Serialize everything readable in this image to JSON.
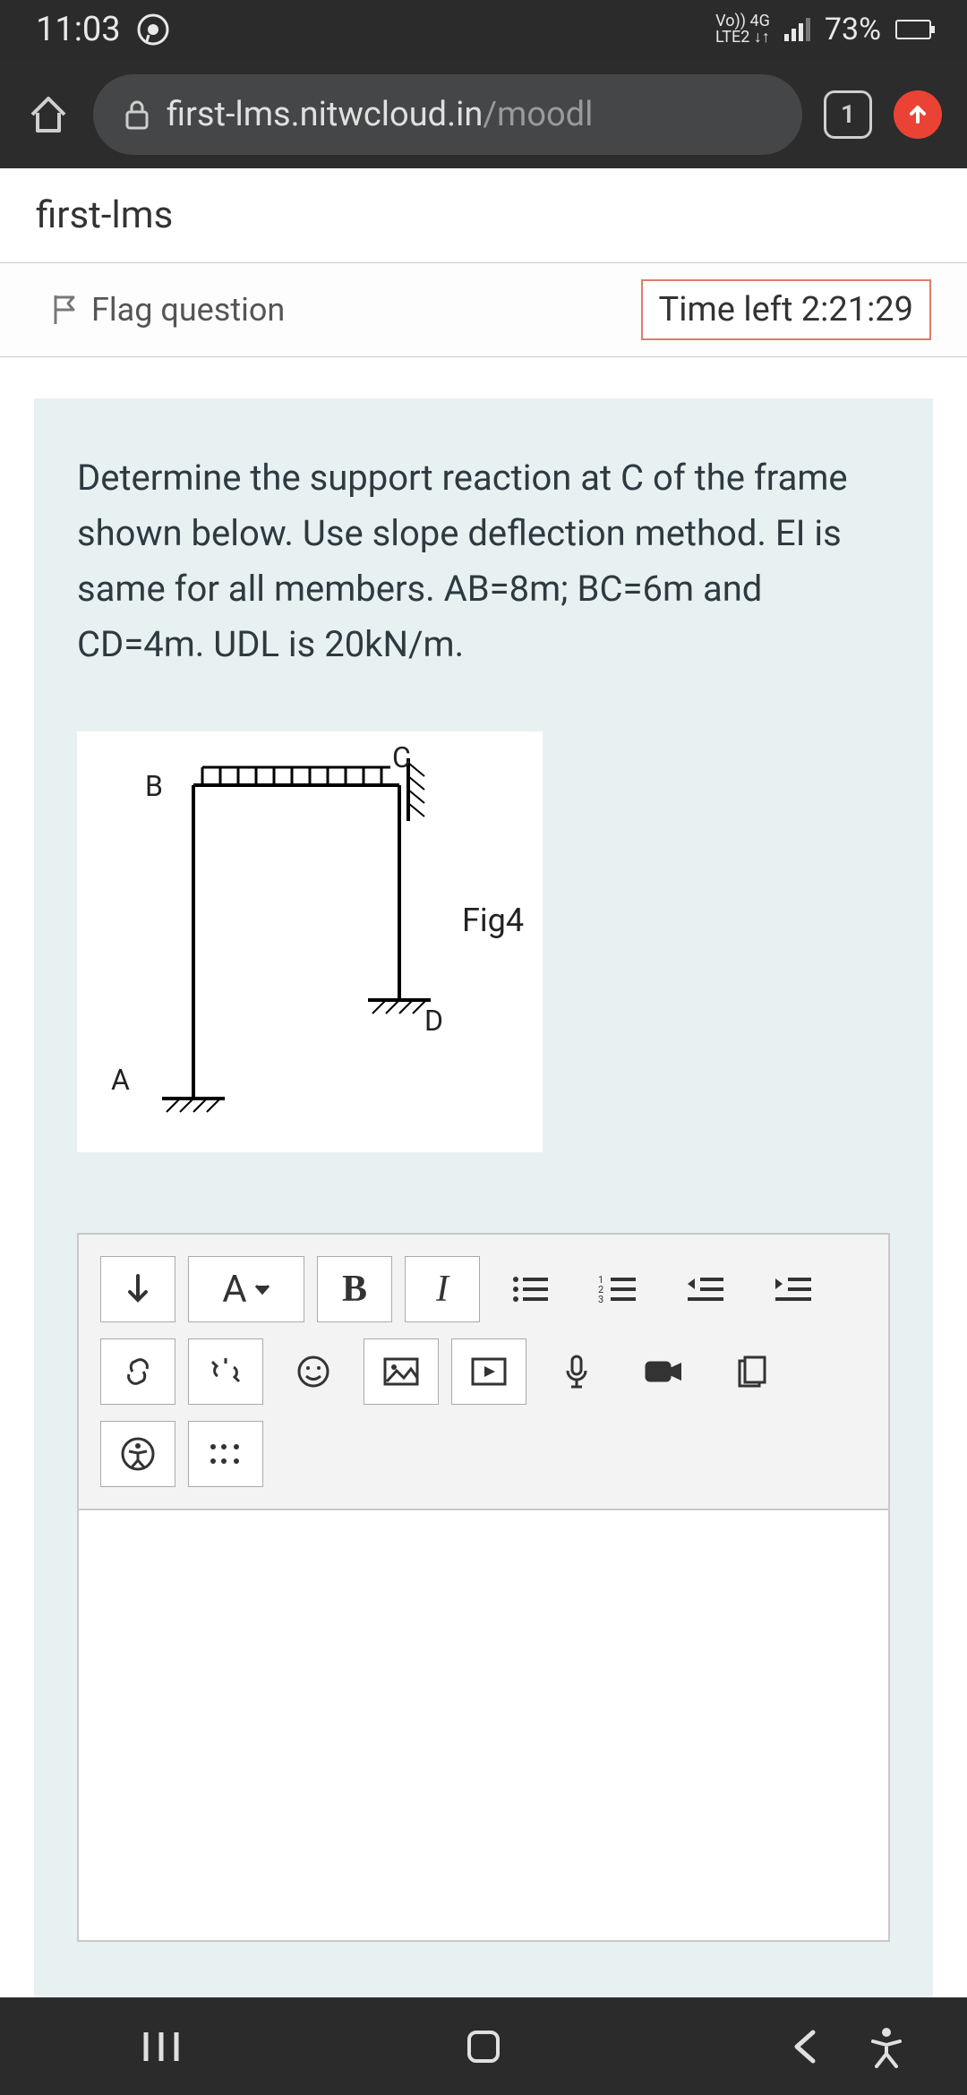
{
  "status": {
    "time": "11:03",
    "net_top": "Vo)) 4G",
    "net_bot": "LTE2 ↓↑",
    "battery_pct": "73%"
  },
  "browser": {
    "domain": "first-lms.nitwcloud.in",
    "path": "/moodl",
    "tab_count": "1"
  },
  "page": {
    "site_name": "first-lms",
    "flag_label": "Flag question",
    "time_left_label": "Time left 2:21:29",
    "question_text": "Determine the support reaction at C of the frame shown below. Use slope deflection method. EI is same for all members. AB=8m; BC=6m and CD=4m. UDL is 20kN/m.",
    "figure": {
      "A": "A",
      "B": "B",
      "C": "C",
      "D": "D",
      "caption": "Fig4"
    }
  },
  "toolbar": {
    "font_menu": "A",
    "bold": "B",
    "italic": "I"
  }
}
